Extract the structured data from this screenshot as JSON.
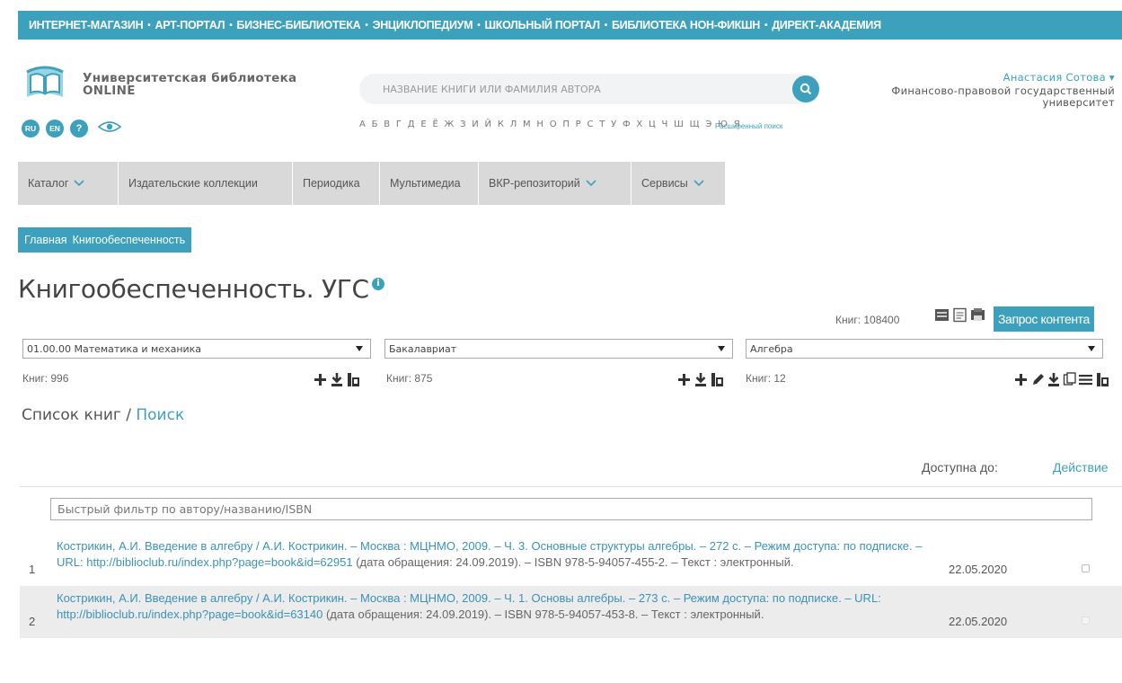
{
  "topbar": {
    "links": [
      "ИНТЕРНЕТ-МАГАЗИН",
      "АРТ-ПОРТАЛ",
      "БИЗНЕС-БИБЛИОТЕКА",
      "ЭНЦИКЛОПЕДИУМ",
      "ШКОЛЬНЫЙ ПОРТАЛ",
      "БИБЛИОТЕКА НОН-ФИКШН",
      "ДИРЕКТ-АКАДЕМИЯ"
    ],
    "separator": "•"
  },
  "brand": {
    "line1": "Университетская библиотека",
    "line2": "ONLINE"
  },
  "lang": {
    "ru": "RU",
    "en": "EN",
    "help": "?"
  },
  "search": {
    "placeholder": "НАЗВАНИЕ КНИГИ ИЛИ ФАМИЛИЯ АВТОРА",
    "alphabet": "А Б В Г Д Е Ё Ж З И Й К Л М Н О П Р С Т У Ф Х Ц Ч Ш Щ Э Ю Я",
    "advanced": "Расширенный поиск"
  },
  "user": {
    "name": "Анастасия Сотова ▾",
    "org1": "Финансово-правовой государственный",
    "org2": "университет"
  },
  "nav": {
    "catalog": "Каталог",
    "publishers": "Издательские коллекции",
    "periodicals": "Периодика",
    "multimedia": "Мультимедиа",
    "vkr": "ВКР-репозиторий",
    "services": "Сервисы"
  },
  "breadcrumb": {
    "home": "Главная",
    "current": "Книгообеспеченность"
  },
  "page": {
    "title": "Книгообеспеченность. УГС",
    "info": "i",
    "books_total": "Книг: 108400",
    "request_button": "Запрос контента"
  },
  "filters": {
    "ugs": {
      "value": "01.00.00 Математика и механика",
      "count": "Книг: 996"
    },
    "level": {
      "value": "Бакалавриат",
      "count": "Книг: 875"
    },
    "discipline": {
      "value": "Алгебра",
      "count": "Книг: 12"
    }
  },
  "list": {
    "heading": "Список книг / ",
    "search_link": "Поиск",
    "col_available": "Доступна до:",
    "col_action": "Действие",
    "filter_placeholder": "Быстрый фильтр по автору/названию/ISBN",
    "rows": [
      {
        "num": "1",
        "link": "Кострикин, А.И. Введение в алгебру / А.И. Кострикин. – Москва : МЦНМО, 2009. – Ч. 3. Основные структуры алгебры. – 272 с. – Режим доступа: по подписке. – URL: http://biblioclub.ru/index.php?page=book&id=62951",
        "rest": " (дата обращения: 24.09.2019). – ISBN 978-5-94057-455-2. – Текст : электронный.",
        "date": "22.05.2020"
      },
      {
        "num": "2",
        "link": "Кострикин, А.И. Введение в алгебру / А.И. Кострикин. – Москва : МЦНМО, 2009. – Ч. 1. Основы алгебры. – 273 с. – Режим доступа: по подписке. – URL: http://biblioclub.ru/index.php?page=book&id=63140",
        "rest": " (дата обращения: 24.09.2019). – ISBN 978-5-94057-453-8. – Текст : электронный.",
        "date": "22.05.2020"
      }
    ]
  },
  "colors": {
    "accent": "#3da0bd",
    "nav_bg": "#d9d9d9",
    "row_alt": "#ececec",
    "link": "#3a92b8"
  }
}
